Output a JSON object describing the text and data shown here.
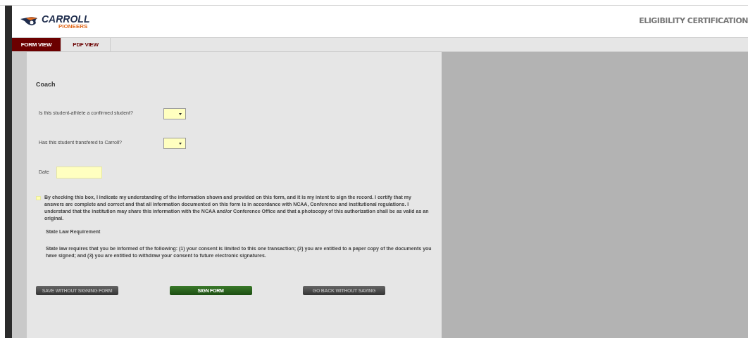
{
  "header": {
    "logo": {
      "name": "CARROLL",
      "subtitle": "PIONEERS"
    },
    "title": "ELIGIBILITY CERTIFICATION"
  },
  "tabs": [
    {
      "label": "FORM VIEW",
      "selected": true
    },
    {
      "label": "PDF VIEW",
      "selected": false
    }
  ],
  "form": {
    "section_title": "Coach",
    "questions": [
      {
        "kind": "select",
        "label": "Is this student-athlete a confirmed student?"
      },
      {
        "kind": "select",
        "label": "Has this student transfered to Carroll?"
      },
      {
        "kind": "date",
        "label": "Date"
      }
    ],
    "certification": {
      "checked": false,
      "text": "By checking this box, I indicate my understanding of the information shown and provided on this form, and it is my intent to sign the record. I certify that my answers are complete and correct and that all information documented on this form is in accordance with NCAA, Conference and institutional regulations. I understand that the institution may share this information with the NCAA and/or Conference Office and that a photocopy of this authorization shall be as valid as an original."
    },
    "state_law_title": "State Law Requirement",
    "state_law_text": "State law requires that you be informed of the following: (1) your consent is limited to this one transaction; (2) you are entitled to a paper copy of the documents you have signed; and (3) you are entitled to withdraw your consent to future electronic signatures.",
    "buttons": [
      {
        "label": "SAVE WITHOUT SIGNING FORM",
        "kind": "secondary"
      },
      {
        "label": "SIGN FORM",
        "kind": "primary"
      },
      {
        "label": "GO BACK WITHOUT SAVING",
        "kind": "secondary"
      }
    ]
  }
}
